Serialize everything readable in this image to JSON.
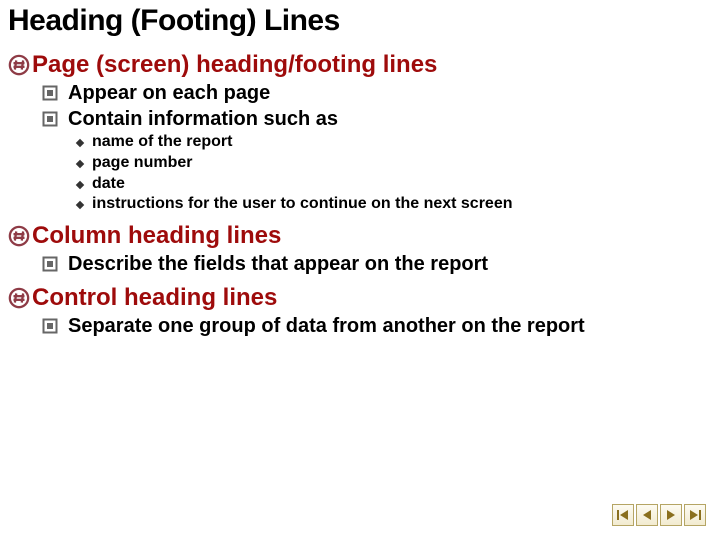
{
  "title": "Heading (Footing) Lines",
  "sections": [
    {
      "heading": "Page (screen) heading/footing lines",
      "level2": [
        {
          "text": "Appear on each page"
        },
        {
          "text": "Contain information such as",
          "level3": [
            "name of the report",
            "page number",
            "date",
            "instructions for the user to continue on the next screen"
          ]
        }
      ]
    },
    {
      "heading": "Column heading lines",
      "level2": [
        {
          "text": "Describe the fields that appear on the report"
        }
      ]
    },
    {
      "heading": "Control heading lines",
      "level2": [
        {
          "text": "Separate one group of data from another on the report"
        }
      ]
    }
  ]
}
